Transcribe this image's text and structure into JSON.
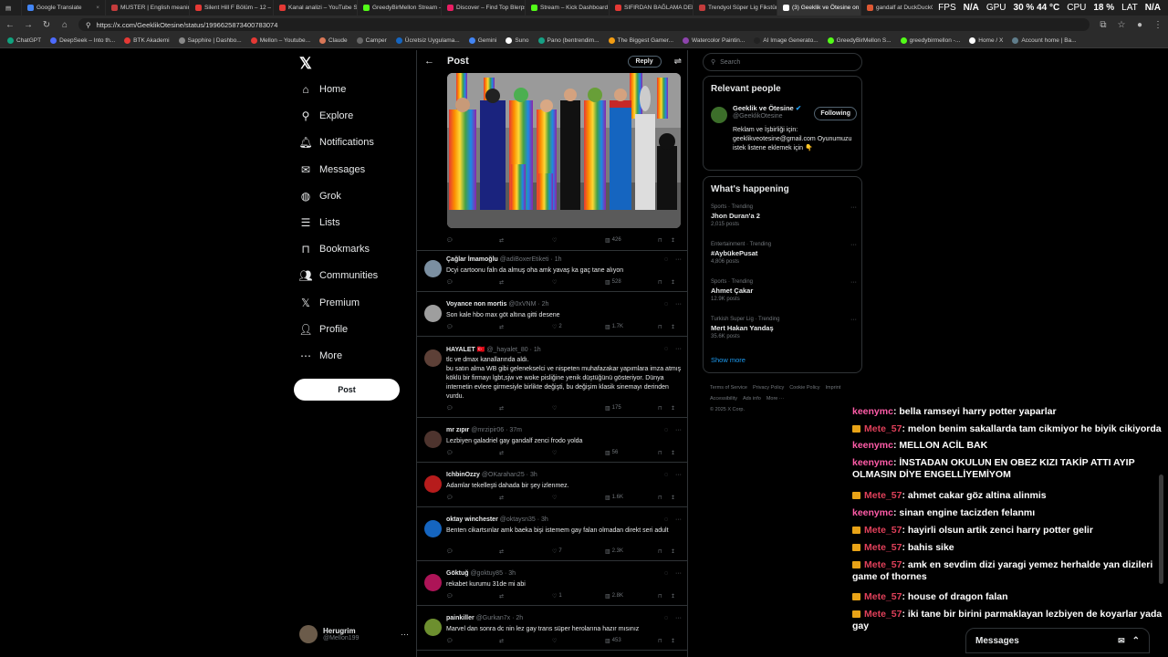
{
  "browser": {
    "tabs": [
      {
        "label": "Google Translate",
        "color": "#4285f4"
      },
      {
        "label": "MUSTER | English meaning",
        "color": "#c43c3c"
      },
      {
        "label": "Silent Hill F Bölüm – 12 – O...",
        "color": "#e53935"
      },
      {
        "label": "Kanal analizi – YouTube Stud...",
        "color": "#e53935"
      },
      {
        "label": "GreedyBirMellon Stream – W...",
        "color": "#53fc18"
      },
      {
        "label": "Discover – Find Top Blerps, Sh...",
        "color": "#e91e63"
      },
      {
        "label": "Stream – Kick Dashboard",
        "color": "#53fc18"
      },
      {
        "label": "SIFIRDAN BAĞLAMA DERSİ",
        "color": "#e53935"
      },
      {
        "label": "Trendyol Süper Lig Fikstürü",
        "color": "#c43c3c"
      },
      {
        "label": "(3) Geeklik ve Ötesine on X...",
        "color": "#ffffff",
        "active": true
      },
      {
        "label": "gandalf at DuckDuckGo",
        "color": "#de5833"
      }
    ],
    "url": "https://x.com/GeeklikOtesine/status/1996625873400783074",
    "bookmarks": [
      "ChatGPT",
      "DeepSeek – Into th...",
      "BTK Akademi",
      "Sapphire | Dashbo...",
      "Mellon – Youtube...",
      "Claude",
      "Camper",
      "Ücretsiz Uygulama...",
      "Gemini",
      "Suno",
      "Pano (bentrendim...",
      "The Biggest Gamer...",
      "Watercolor Paintin...",
      "AI Image Generato...",
      "GreedyBirMellon S...",
      "greedybirmellon -...",
      "Home / X",
      "Account home | Ba..."
    ]
  },
  "overlay": {
    "fps_label": "FPS",
    "fps": "N/A",
    "gpu_label": "GPU",
    "gpu": "30 %  44 °C",
    "cpu_label": "CPU",
    "cpu": "18 %",
    "lat_label": "LAT",
    "lat": "N/A"
  },
  "nav": {
    "items": [
      {
        "label": "Home",
        "icon": "home-icon"
      },
      {
        "label": "Explore",
        "icon": "search-icon"
      },
      {
        "label": "Notifications",
        "icon": "bell-icon"
      },
      {
        "label": "Messages",
        "icon": "mail-icon"
      },
      {
        "label": "Grok",
        "icon": "grok-icon"
      },
      {
        "label": "Lists",
        "icon": "list-icon"
      },
      {
        "label": "Bookmarks",
        "icon": "bookmark-icon"
      },
      {
        "label": "Communities",
        "icon": "people-icon"
      },
      {
        "label": "Premium",
        "icon": "x-icon"
      },
      {
        "label": "Profile",
        "icon": "person-icon"
      },
      {
        "label": "More",
        "icon": "more-icon"
      }
    ],
    "post_label": "Post",
    "account": {
      "name": "Herugrim",
      "handle": "@Mellon199"
    }
  },
  "main": {
    "header_title": "Post",
    "reply_label": "Reply",
    "photo_stats": {
      "views": "426"
    },
    "tweets": [
      {
        "name": "Çağlar İmamoğlu",
        "handle": "@adiBoxerEtiketi",
        "time": "· 1h",
        "text": "Dcyi cartoonu faln da almuş oha amk yavaş ka gaç tane alıyon",
        "likes": "",
        "views": "528"
      },
      {
        "name": "Voyance non mortis",
        "handle": "@0xVNM",
        "time": "· 2h",
        "text": "Son kale hbo max göt altına gitti desene",
        "likes": "2",
        "views": "1.7K"
      },
      {
        "name": "HAYALET 🇹🇷",
        "handle": "@_hayalet_80",
        "time": "· 1h",
        "text": "tlc ve dmax kanallarında aldı.\nbu satın alma WB gibi gelenekselci ve nispeten muhafazakar yapımlara imza atmış köklü bir firmayı lgbt,sjw ve woke pisliğine yenik düştüğünü gösteriyor. Dünya internetin evlere girmesiyle birlikte değişti, bu değişim klasik sinemayı derinden vurdu.",
        "likes": "",
        "views": "175"
      },
      {
        "name": "mr zıpır",
        "handle": "@mrzipir06",
        "time": "· 37m",
        "text": "Lezbiyen galadriel gay gandalf zenci frodo yolda",
        "likes": "",
        "views": "56"
      },
      {
        "name": "IchbinOzzy",
        "handle": "@OKarahan25",
        "time": "· 3h",
        "text": "Adamlar tekelleşti dahada bir şey izlenmez.",
        "likes": "",
        "views": "1.6K"
      },
      {
        "name": "oktay winchester",
        "handle": "@oktaysn35",
        "time": "· 3h",
        "text": "Benten cikartsınlar amk baeka bişi istemem gay falan olmadan direkt seri adult",
        "likes": "7",
        "views": "2.3K"
      },
      {
        "name": "Göktuğ",
        "handle": "@goktuy85",
        "time": "· 3h",
        "text": "rekabet kurumu 31de mi abi",
        "likes": "1",
        "views": "2.8K"
      },
      {
        "name": "painkiller",
        "handle": "@Gurkan7x",
        "time": "· 2h",
        "text": "Marvel dan sonra dc nin lez gay trans süper herolarına hazır mısınız",
        "likes": "",
        "views": "453"
      }
    ]
  },
  "right": {
    "search_placeholder": "Search",
    "relevant_title": "Relevant people",
    "person": {
      "name": "Geeklik ve Ötesine",
      "handle": "@GeeklikOtesine",
      "follow_label": "Following",
      "bio": "Reklam ve İşbirliği için: geeklikveotesine@gmail.com Oyunumuzu istek listene eklemek için 👇"
    },
    "happening_title": "What's happening",
    "trends": [
      {
        "category": "Sports · Trending",
        "name": "Jhon Duran'a 2",
        "count": "2,015 posts"
      },
      {
        "category": "Entertainment · Trending",
        "name": "#AybükePusat",
        "count": "4,806 posts"
      },
      {
        "category": "Sports · Trending",
        "name": "Ahmet Çakar",
        "count": "12.9K posts"
      },
      {
        "category": "Turkish Super Lig · Trending",
        "name": "Mert Hakan Yandaş",
        "count": "35.6K posts"
      }
    ],
    "show_more": "Show more",
    "footer": [
      "Terms of Service",
      "Privacy Policy",
      "Cookie Policy",
      "Imprint",
      "Accessibility",
      "Ads info",
      "More ···",
      "© 2025 X Corp."
    ]
  },
  "chat": [
    {
      "user": "keenymc",
      "text": ": bella ramseyi harry potter yaparlar",
      "badge": false
    },
    {
      "user": "Mete_57",
      "text": ": melon benim sakallarda tam cikmiyor he biyik cikiyorda",
      "badge": true
    },
    {
      "user": "keenymc",
      "text": ": MELLON ACİL BAK",
      "badge": false
    },
    {
      "user": "keenymc",
      "text": ": İNSTADAN OKULUN EN OBEZ KIZI TAKİP ATTI AYIP OLMASIN DİYE ENGELLİYEMİYOM",
      "badge": false
    },
    {
      "user": "Mete_57",
      "text": ": ahmet cakar göz altina alinmis",
      "badge": true
    },
    {
      "user": "keenymc",
      "text": ": sinan engine tacizden felanmı",
      "badge": false
    },
    {
      "user": "Mete_57",
      "text": ": hayirli olsun artik zenci harry potter gelir",
      "badge": true
    },
    {
      "user": "Mete_57",
      "text": ": bahis sike",
      "badge": true
    },
    {
      "user": "Mete_57",
      "text": ": amk en sevdim dizi yaragi yemez herhalde yan dizileri game of thornes",
      "badge": true
    },
    {
      "user": "Mete_57",
      "text": ": house of dragon falan",
      "badge": true
    },
    {
      "user": "Mete_57",
      "text": ": iki tane bir birini parmaklayan lezbiyen de koyarlar yada gay",
      "badge": true
    }
  ],
  "messages_bar": {
    "label": "Messages"
  }
}
